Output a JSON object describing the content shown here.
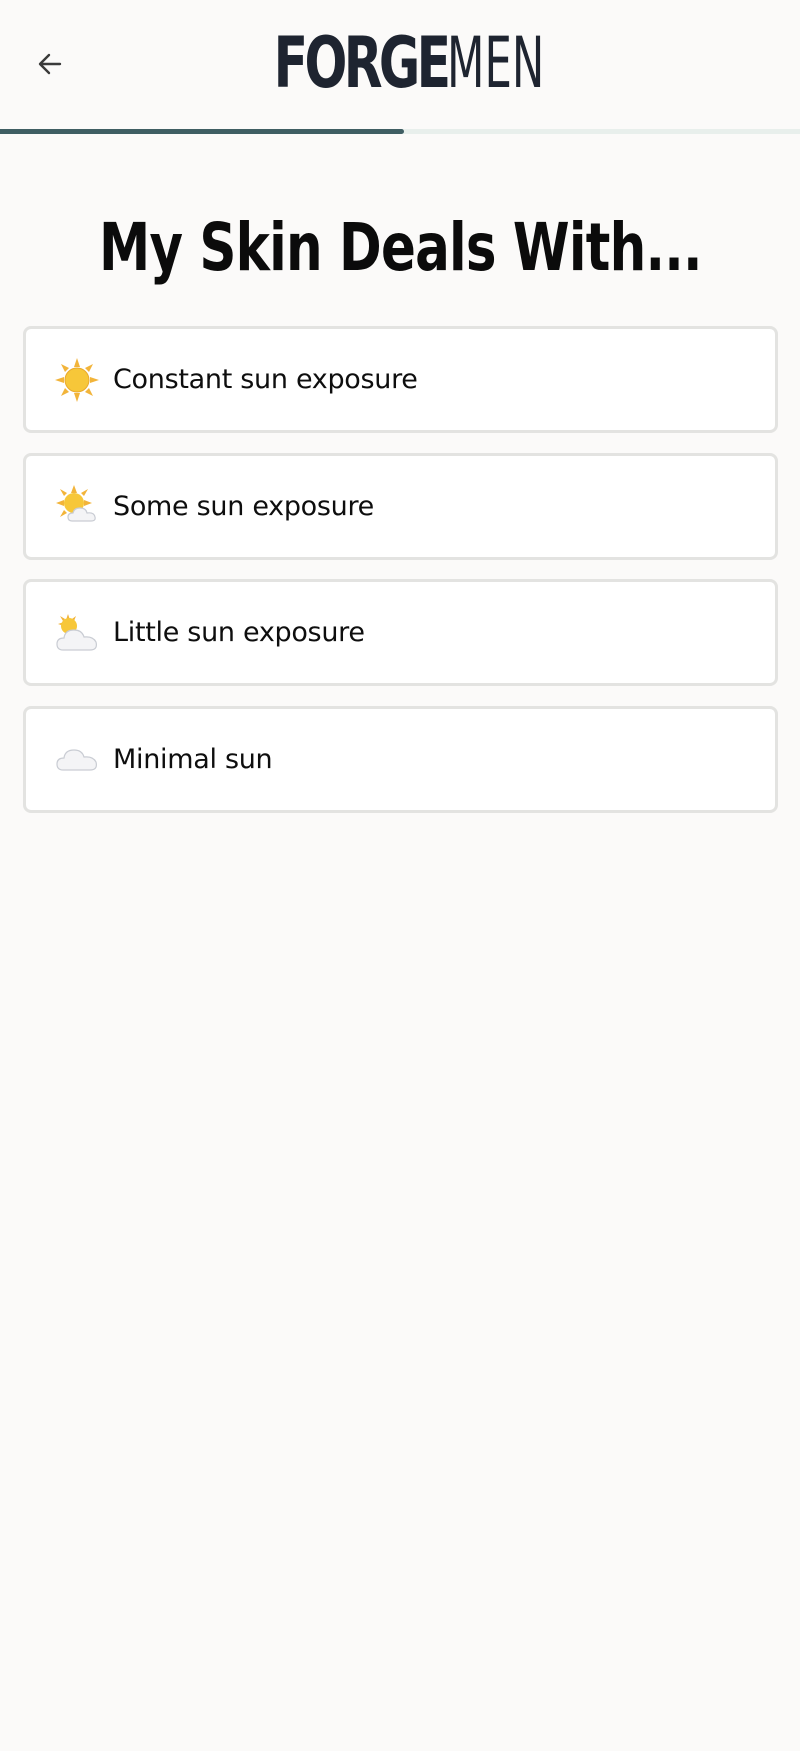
{
  "header": {
    "back_icon": "arrow-left-icon",
    "logo": {
      "bold_part": "FORGE",
      "light_part": "MEN"
    }
  },
  "progress": {
    "fraction": 0.505,
    "fill_color": "#3f5e63",
    "track_color": "#e8efec"
  },
  "question": {
    "title": "My Skin Deals With..."
  },
  "options": [
    {
      "label": "Constant sun exposure",
      "icon": "sun-icon"
    },
    {
      "label": "Some sun exposure",
      "icon": "sun-behind-small-cloud-icon"
    },
    {
      "label": "Little sun exposure",
      "icon": "sun-behind-large-cloud-icon"
    },
    {
      "label": "Minimal sun",
      "icon": "cloud-icon"
    }
  ]
}
